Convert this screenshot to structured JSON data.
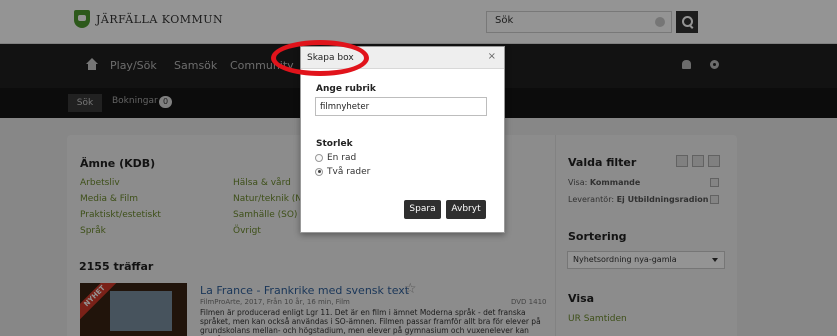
{
  "header": {
    "logo_text": "JÄRFÄLLA KOMMUN",
    "search_value": "Sök"
  },
  "nav": {
    "items": [
      "Play/Sök",
      "Samsök",
      "Community"
    ]
  },
  "subnav": {
    "tab_active": "Sök",
    "bookings_label": "Bokningar",
    "bookings_count": "0"
  },
  "filters": {
    "subject_heading": "Ämne (KDB)",
    "subjects_col1": [
      "Arbetsliv",
      "Media & Film",
      "Praktiskt/estetiskt",
      "Språk"
    ],
    "subjects_col2": [
      "Hälsa & vård",
      "Natur/teknik (N",
      "Samhälle (SO)",
      "Övrigt"
    ]
  },
  "results": {
    "hits": "2155 träffar",
    "badge": "NYHET",
    "item_title": "La France - Frankrike med svensk text",
    "item_meta": "FilmProArte, 2017, Från 10 år, 16 min, Film",
    "item_format": "DVD 1410",
    "item_description": "Filmen är producerad enligt Lgr 11. Det är en film i ämnet Moderna språk - det franska språket, men kan också användas i SO-ämnen. Filmen passar framför allt bra för elever på grundskolans mellan- och högstadium, men elever på gymnasium och vuxenelever kan också"
  },
  "sidebar": {
    "selected_heading": "Valda filter",
    "filter_show_label": "Visa:",
    "filter_show_value": "Kommande",
    "filter_supplier_label": "Leverantör:",
    "filter_supplier_value": "Ej Utbildningsradion",
    "sort_heading": "Sortering",
    "sort_value": "Nyhetsordning nya-gamla",
    "show_heading": "Visa",
    "show_item": "UR Samtiden"
  },
  "modal": {
    "title": "Skapa box",
    "close": "×",
    "heading_label": "Ange rubrik",
    "heading_value": "filmnyheter",
    "size_label": "Storlek",
    "option_one_row": "En rad",
    "option_two_rows": "Två rader",
    "selected_option": "Två rader",
    "save_label": "Spara",
    "cancel_label": "Avbryt"
  },
  "annotation": {
    "ring_color": "#e1131b"
  }
}
